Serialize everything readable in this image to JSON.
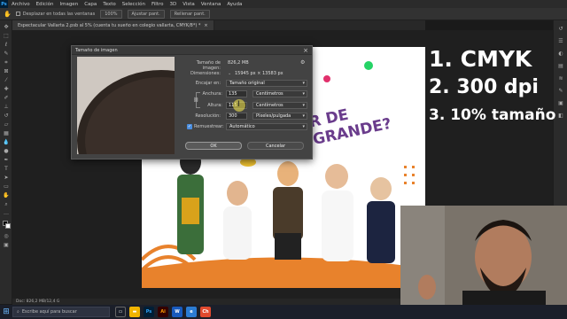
{
  "menubar": {
    "logo": "Ps",
    "items": [
      "Archivo",
      "Edición",
      "Imagen",
      "Capa",
      "Texto",
      "Selección",
      "Filtro",
      "3D",
      "Vista",
      "Ventana",
      "Ayuda"
    ]
  },
  "options_bar": {
    "checkbox_label": "Desplazar en todas las ventanas",
    "zoom": "100%",
    "fit_label": "Ajustar pant.",
    "fill_label": "Rellenar pant."
  },
  "document_tab": {
    "title": "Espectacular Vallarta 2.psb al 5% (cuenta tu sueño en colegio vallarta, CMYK/8*) *",
    "close": "×"
  },
  "status_bar": {
    "text": "Doc: 826,2 MB/12,4 G"
  },
  "dialog": {
    "title": "Tamaño de imagen",
    "size_label": "Tamaño de imagen:",
    "size_value": "826,2 MB",
    "dimensions_label": "Dimensiones:",
    "dimensions_value": "15945 px × 13583 px",
    "fit_label": "Encajar en:",
    "fit_value": "Tamaño original",
    "width_label": "Anchura:",
    "width_value": "135",
    "width_unit": "Centímetros",
    "height_label": "Altura:",
    "height_value": "115",
    "height_unit": "Centímetros",
    "resolution_label": "Resolución:",
    "resolution_value": "300",
    "resolution_unit": "Píxeles/pulgada",
    "resample_label": "Remuestrear:",
    "resample_value": "Automático",
    "ok_label": "OK",
    "cancel_label": "Cancelar"
  },
  "overlay": {
    "line1": "1. CMYK",
    "line2": "2. 300 dpi",
    "line3": "3. 10% tamaño"
  },
  "poster": {
    "headline": "R DE GRANDE?"
  },
  "taskbar": {
    "search_placeholder": "Escribe aquí para buscar",
    "apps": [
      {
        "label": "Ps",
        "color": "#001e36"
      },
      {
        "label": "Ai",
        "color": "#330000"
      },
      {
        "label": "W",
        "color": "#185abd"
      },
      {
        "label": "e",
        "color": "#2b7cd3"
      },
      {
        "label": "Ch",
        "color": "#e04a2f"
      }
    ]
  },
  "colors": {
    "accent_orange": "#e8822c",
    "overlay_text": "#ffffff",
    "poster_purple": "#6a3c8c"
  }
}
